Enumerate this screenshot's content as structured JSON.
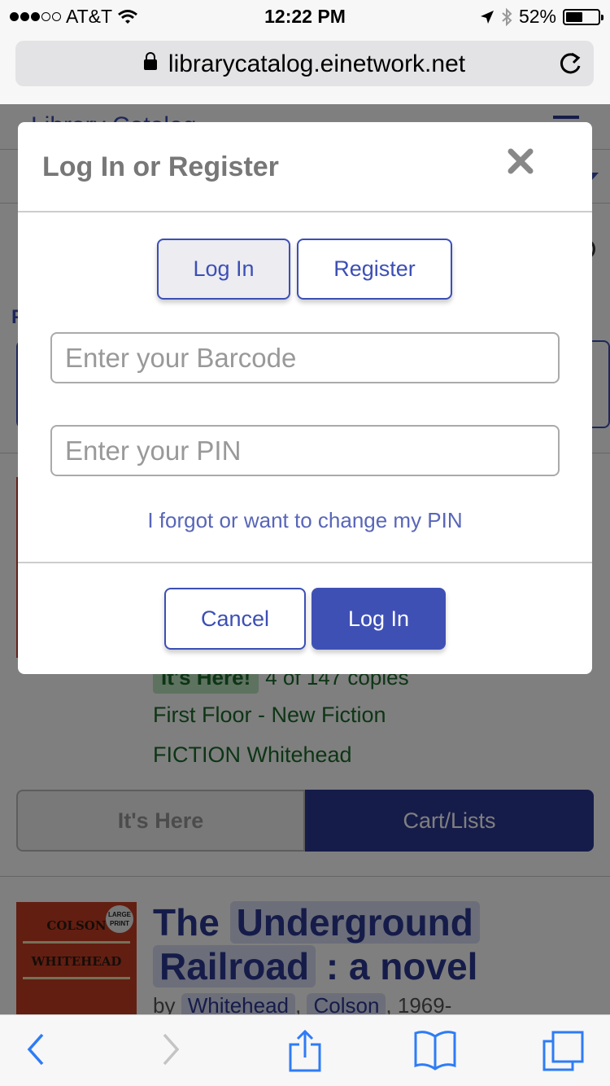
{
  "status_bar": {
    "carrier": "AT&T",
    "time": "12:22 PM",
    "battery": "52%"
  },
  "browser": {
    "url": "librarycatalog.einetwork.net"
  },
  "background_page": {
    "header_title": "Library Catalog",
    "side_letter": "F",
    "availability_badge": "It's Here!",
    "availability_count": "4 of 147 copies",
    "location": "First Floor - New Fiction",
    "call_number": "FICTION Whitehead",
    "here_button": "It's Here",
    "cart_button": "Cart/Lists",
    "book": {
      "title_part1": "The",
      "title_part2": "Underground",
      "title_part3": "Railroad",
      "title_part4": ": a novel",
      "by": "by",
      "author_last": "Whitehead",
      "author_first": "Colson",
      "years": ", 1969-",
      "cover_author1": "COLSON",
      "cover_author2": "WHITEHEAD",
      "cover_badge": "LARGE PRINT"
    }
  },
  "modal": {
    "title": "Log In or Register",
    "tab_login": "Log In",
    "tab_register": "Register",
    "barcode_placeholder": "Enter your Barcode",
    "barcode_value": "",
    "pin_placeholder": "Enter your PIN",
    "pin_value": "",
    "forgot_link": "I forgot or want to change my PIN",
    "cancel_button": "Cancel",
    "login_button": "Log In"
  },
  "toolbar": {
    "icons": [
      "back-icon",
      "forward-icon",
      "share-icon",
      "bookmarks-icon",
      "tabs-icon"
    ]
  },
  "colors": {
    "accent": "#3f50b5",
    "accent_dark": "#2c3893",
    "available_green": "#1a6b2a"
  }
}
